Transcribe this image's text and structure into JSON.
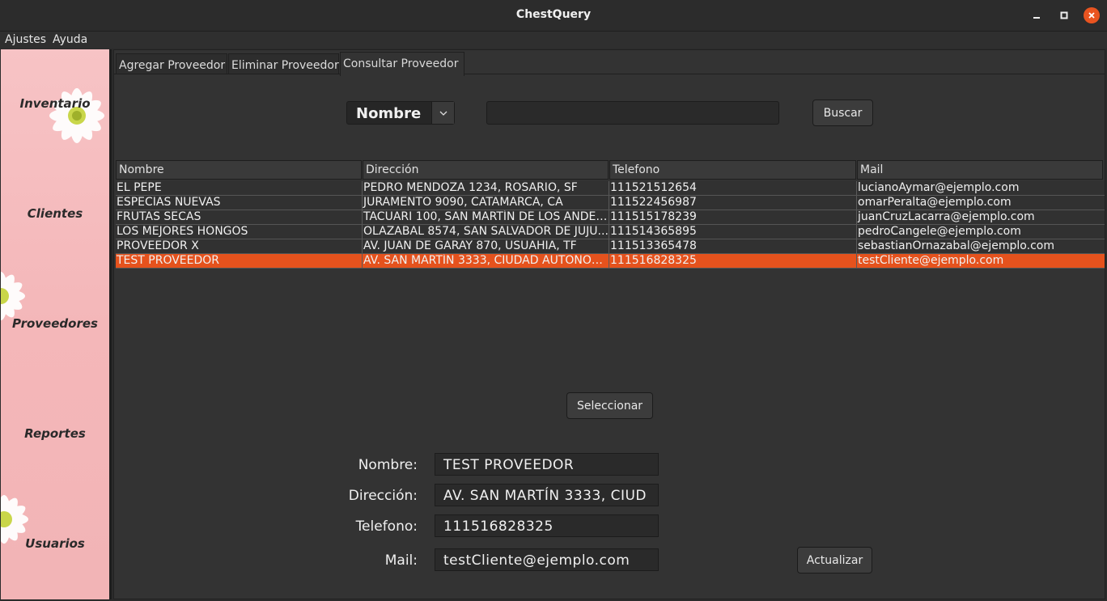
{
  "window": {
    "title": "ChestQuery"
  },
  "menu": {
    "items": [
      "Ajustes",
      "Ayuda"
    ]
  },
  "sidebar": {
    "items": [
      "Inventario",
      "Clientes",
      "Proveedores",
      "Reportes",
      "Usuarios"
    ]
  },
  "tabs": [
    "Agregar Proveedor",
    "Eliminar Proveedor",
    "Consultar Proveedor"
  ],
  "active_tab": "Consultar Proveedor",
  "search": {
    "field_selected": "Nombre",
    "query": "",
    "button": "Buscar"
  },
  "table": {
    "columns": [
      "Nombre",
      "Dirección",
      "Telefono",
      "Mail"
    ],
    "rows": [
      [
        "EL PEPE",
        "PEDRO MENDOZA 1234, ROSARIO, SF",
        "111521512654",
        "lucianoAymar@ejemplo.com"
      ],
      [
        "ESPECIAS NUEVAS",
        "JURAMENTO 9090, CATAMARCA, CA",
        "111522456987",
        "omarPeralta@ejemplo.com"
      ],
      [
        "FRUTAS SECAS",
        "TACUARI 100, SAN MARTÍN DE LOS ANDES, ...",
        "111515178239",
        "juanCruzLacarra@ejemplo.com"
      ],
      [
        "LOS MEJORES HONGOS",
        "OLAZABAL 8574, SAN SALVADOR DE JUJU...",
        "111514365895",
        "pedroCangele@ejemplo.com"
      ],
      [
        "PROVEEDOR X",
        "AV. JUAN DE GARAY 870, USUAHIA, TF",
        "111513365478",
        "sebastianOrnazabal@ejemplo.com"
      ],
      [
        "TEST PROVEEDOR",
        "AV. SAN MARTÍN 3333, CIUDAD AUTONOM...",
        "111516828325",
        "testCliente@ejemplo.com"
      ]
    ],
    "selected_row": "TEST PROVEEDOR"
  },
  "select_button": "Seleccionar",
  "form": {
    "nombre_label": "Nombre:",
    "nombre": "TEST PROVEEDOR",
    "direccion_label": "Dirección:",
    "direccion": "AV. SAN MARTÍN 3333, CIUD",
    "telefono_label": "Telefono:",
    "telefono": "111516828325",
    "mail_label": "Mail:",
    "mail": "testCliente@ejemplo.com",
    "update_button": "Actualizar"
  },
  "colors": {
    "accent": "#e5521d",
    "sidebar_bg": "#f4b7b9",
    "panel_bg": "#333333"
  }
}
